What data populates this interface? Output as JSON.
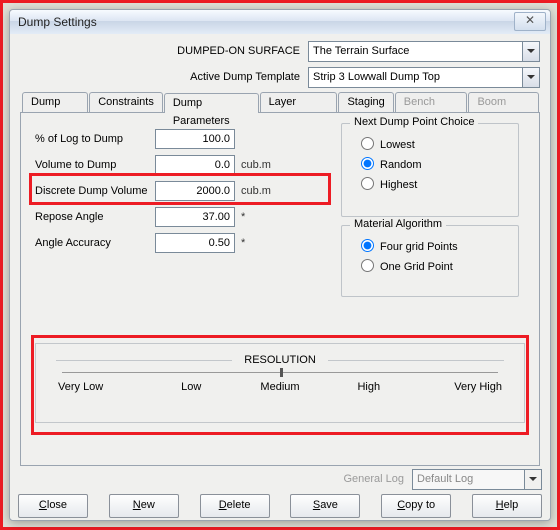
{
  "window": {
    "title": "Dump Settings"
  },
  "top": {
    "surface_label": "DUMPED-ON SURFACE",
    "surface_value": "The Terrain Surface",
    "template_label": "Active Dump Template",
    "template_value": "Strip 3 Lowwall Dump Top"
  },
  "tabs": {
    "items": [
      "Dump Type",
      "Constraints",
      "Dump Parameters",
      "Layer Material",
      "Staging",
      "Bench Dump",
      "Boom Dump"
    ],
    "active": 2,
    "disabled": [
      5,
      6
    ]
  },
  "params": {
    "rows": [
      {
        "label": "% of Log to Dump",
        "value": "100.0",
        "unit": ""
      },
      {
        "label": "Volume to Dump",
        "value": "0.0",
        "unit": "cub.m"
      },
      {
        "label": "Discrete Dump Volume",
        "value": "2000.0",
        "unit": "cub.m"
      },
      {
        "label": "Repose Angle",
        "value": "37.00",
        "unit": "*"
      },
      {
        "label": "Angle Accuracy",
        "value": "0.50",
        "unit": "*"
      }
    ]
  },
  "next_point": {
    "legend": "Next Dump Point Choice",
    "options": [
      "Lowest",
      "Random",
      "Highest"
    ],
    "selected": 1
  },
  "mat_algo": {
    "legend": "Material Algorithm",
    "options": [
      "Four grid Points",
      "One Grid Point"
    ],
    "selected": 0
  },
  "resolution": {
    "title": "RESOLUTION",
    "labels": [
      "Very Low",
      "Low",
      "Medium",
      "High",
      "Very High"
    ]
  },
  "bottom": {
    "genlog_label": "General Log",
    "genlog_value": "Default Log",
    "buttons": [
      "Close",
      "New",
      "Delete",
      "Save",
      "Copy to",
      "Help"
    ]
  }
}
